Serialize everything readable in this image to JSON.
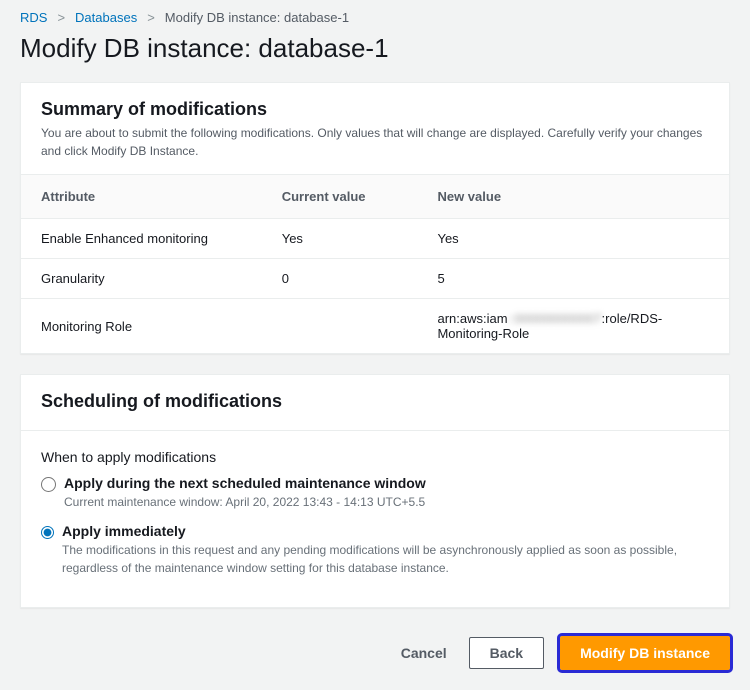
{
  "breadcrumb": {
    "root": "RDS",
    "databases": "Databases",
    "current": "Modify DB instance: database-1"
  },
  "page_title": "Modify DB instance: database-1",
  "summary_panel": {
    "title": "Summary of modifications",
    "description": "You are about to submit the following modifications. Only values that will change are displayed. Carefully verify your changes and click Modify DB Instance.",
    "columns": {
      "attr": "Attribute",
      "current": "Current value",
      "new": "New value"
    },
    "rows": [
      {
        "attr": "Enable Enhanced monitoring",
        "current": "Yes",
        "new": "Yes"
      },
      {
        "attr": "Granularity",
        "current": "0",
        "new": "5"
      },
      {
        "attr": "Monitoring Role",
        "current": "",
        "new_prefix": "arn:aws:iam",
        "new_blur": "::000000000007",
        "new_suffix": ":role/RDS-Monitoring-Role"
      }
    ]
  },
  "scheduling_panel": {
    "title": "Scheduling of modifications",
    "label": "When to apply modifications",
    "option_scheduled": {
      "label": "Apply during the next scheduled maintenance window",
      "desc": "Current maintenance window: April 20, 2022 13:43 - 14:13 UTC+5.5"
    },
    "option_immediate": {
      "label": "Apply immediately",
      "desc": "The modifications in this request and any pending modifications will be asynchronously applied as soon as possible, regardless of the maintenance window setting for this database instance."
    }
  },
  "actions": {
    "cancel": "Cancel",
    "back": "Back",
    "submit": "Modify DB instance"
  }
}
